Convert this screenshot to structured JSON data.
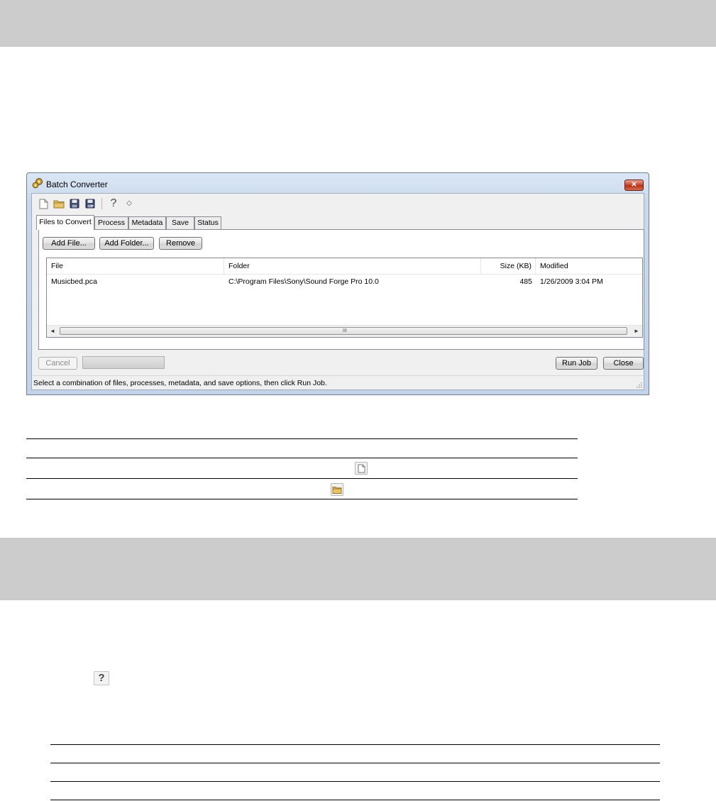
{
  "window": {
    "title": "Batch Converter",
    "close_glyph": "✕"
  },
  "toolbar": {
    "icons": [
      "new-file-icon",
      "open-folder-icon",
      "save-icon",
      "save-as-icon",
      "help-icon",
      "whats-this-icon"
    ],
    "help_glyph": "?",
    "whats_this_glyph": "◇"
  },
  "tabs": [
    {
      "label": "Files to Convert",
      "active": true
    },
    {
      "label": "Process",
      "active": false
    },
    {
      "label": "Metadata",
      "active": false
    },
    {
      "label": "Save",
      "active": false
    },
    {
      "label": "Status",
      "active": false
    }
  ],
  "files_panel": {
    "add_file_label": "Add File...",
    "add_folder_label": "Add Folder...",
    "remove_label": "Remove",
    "columns": [
      "File",
      "Folder",
      "Size (KB)",
      "Modified"
    ],
    "rows": [
      {
        "file": "Musicbed.pca",
        "folder": "C:\\Program Files\\Sony\\Sound Forge Pro 10.0",
        "size_kb": "485",
        "modified": "1/26/2009 3:04 PM"
      }
    ],
    "scroll_left": "◄",
    "scroll_right": "►",
    "scroll_grip": "III"
  },
  "footer": {
    "cancel_label": "Cancel",
    "run_job_label": "Run Job",
    "close_label": "Close"
  },
  "status_text": "Select a combination of files, processes, metadata, and save options, then click Run Job.",
  "page": {
    "help_icon_glyph": "?"
  },
  "colors": {
    "band": "#cccccc",
    "window_frame": "#c2d3ea",
    "close_button": "#c7432a"
  }
}
